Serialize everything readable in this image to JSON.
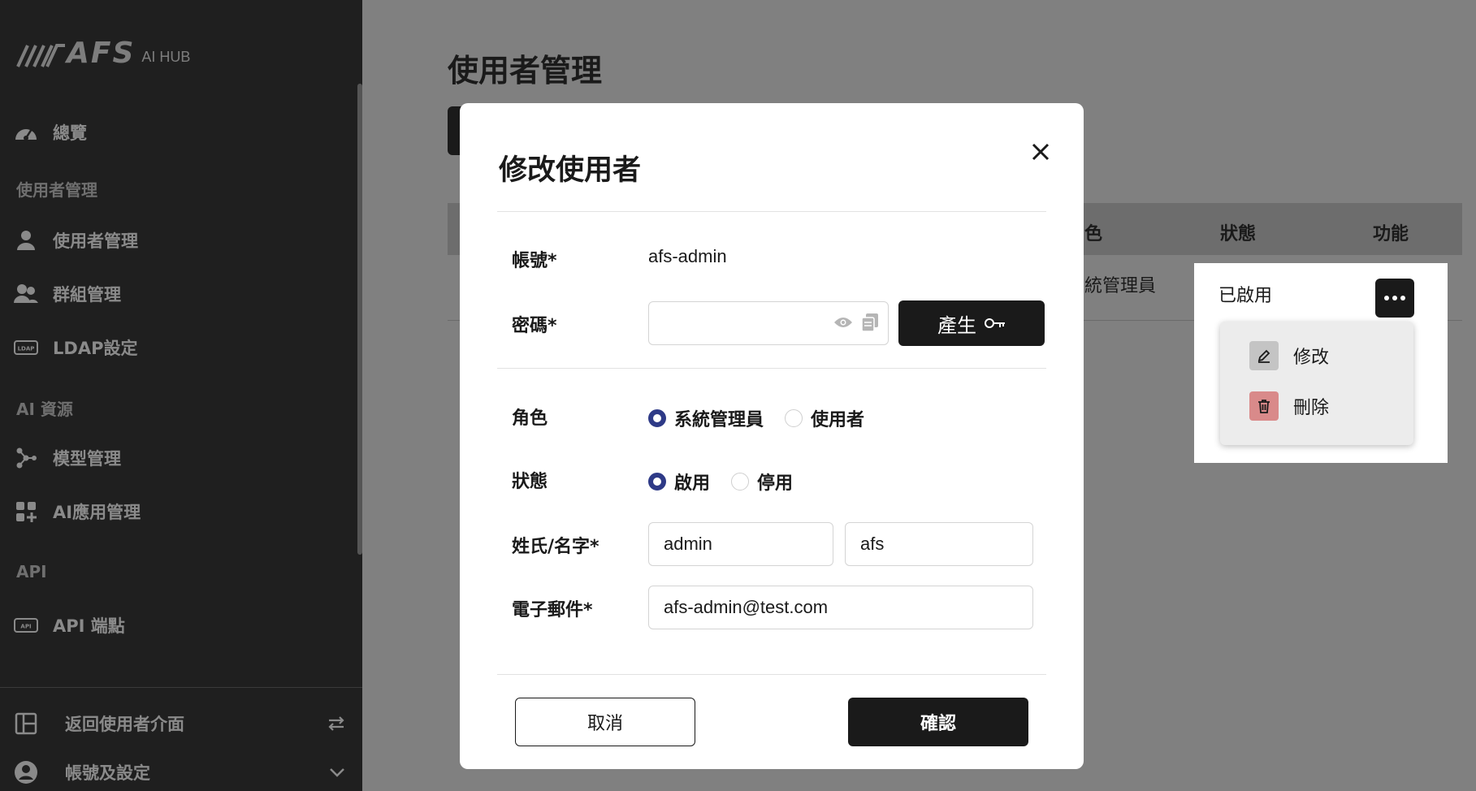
{
  "brand": {
    "logo_text": "AFS",
    "logo_sub": "AI HUB"
  },
  "sidebar": {
    "items": [
      {
        "label": "總覽",
        "icon": "dashboard-icon"
      },
      {
        "label": "使用者管理",
        "icon": "user-icon"
      },
      {
        "label": "群組管理",
        "icon": "group-icon"
      },
      {
        "label": "LDAP設定",
        "icon": "ldap-icon"
      },
      {
        "label": "模型管理",
        "icon": "model-icon"
      },
      {
        "label": "AI應用管理",
        "icon": "apps-icon"
      },
      {
        "label": "API 端點",
        "icon": "api-icon"
      }
    ],
    "sections": [
      "使用者管理",
      "AI 資源",
      "API"
    ],
    "bottom": [
      {
        "label": "返回使用者介面",
        "icon": "layout-icon",
        "trail_icon": "swap-icon"
      },
      {
        "label": "帳號及設定",
        "icon": "account-icon",
        "trail_icon": "chevron-down-icon"
      }
    ]
  },
  "main": {
    "title": "使用者管理",
    "table": {
      "headers": [
        "色",
        "狀態",
        "功能"
      ],
      "row": {
        "role": "統管理員",
        "status": "已啟用"
      }
    }
  },
  "row_menu": {
    "items": [
      "修改",
      "刪除"
    ]
  },
  "modal": {
    "title": "修改使用者",
    "fields": {
      "account_label": "帳號*",
      "account_value": "afs-admin",
      "password_label": "密碼*",
      "password_value": "",
      "generate_label": "產生",
      "role_label": "角色",
      "role_options": [
        "系統管理員",
        "使用者"
      ],
      "status_label": "狀態",
      "status_options": [
        "啟用",
        "停用"
      ],
      "name_label": "姓氏/名字*",
      "last_name": "admin",
      "first_name": "afs",
      "email_label": "電子郵件*",
      "email": "afs-admin@test.com"
    },
    "cancel_label": "取消",
    "confirm_label": "確認"
  },
  "colors": {
    "accent": "#2e3a87",
    "dark": "#1a1a1a",
    "delete": "#d98a8a",
    "edit": "#c4c4c4"
  }
}
